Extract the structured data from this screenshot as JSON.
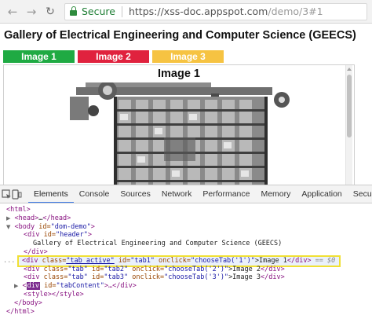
{
  "browser": {
    "secure_label": "Secure",
    "url_host": "https://xss-doc.appspot.com",
    "url_path": "/demo/3#1"
  },
  "page": {
    "title": "Gallery of Electrical Engineering and Computer Science (GEECS)",
    "tabs": [
      {
        "label": "Image 1",
        "color": "#1faa43"
      },
      {
        "label": "Image 2",
        "color": "#e0223e"
      },
      {
        "label": "Image 3",
        "color": "#f6c342"
      }
    ],
    "content_heading": "Image 1"
  },
  "devtools": {
    "tabs": [
      "Elements",
      "Console",
      "Sources",
      "Network",
      "Performance",
      "Memory",
      "Application",
      "Security"
    ],
    "active_tab": "Elements",
    "dom": {
      "l1": "<html>",
      "l2_open": "<head>",
      "l2_dots": "…",
      "l2_close": "</head>",
      "l3_tag": "<body",
      "l3_attr": " id=",
      "l3_val": "\"dom-demo\"",
      "l3_end": ">",
      "l4_tag": "<div",
      "l4_attr": " id=",
      "l4_val": "\"header\"",
      "l4_end": ">",
      "l5_text": "Gallery of Electrical Engineering and Computer Science (GEECS)",
      "l6_close": "</div>",
      "sel_gutter": "...",
      "sel_tag": "<div",
      "sel_attr1": " class=",
      "sel_val1": "\"tab active\"",
      "sel_attr2": " id=",
      "sel_val2": "\"tab1\"",
      "sel_attr3": " onclick=",
      "sel_val3": "\"chooseTab('1')\"",
      "sel_text": ">Image 1",
      "sel_close": "</div>",
      "sel_eq": " == $0",
      "r2_tag": "<div",
      "r2_attr1": " class=",
      "r2_val1": "\"tab\"",
      "r2_attr2": " id=",
      "r2_val2": "\"tab2\"",
      "r2_attr3": " onclick=",
      "r2_val3": "\"chooseTab('2')\"",
      "r2_text": ">Image 2",
      "r2_close": "</div>",
      "r3_tag": "<div",
      "r3_attr1": " class=",
      "r3_val1": "\"tab\"",
      "r3_attr2": " id=",
      "r3_val2": "\"tab3\"",
      "r3_attr3": " onclick=",
      "r3_val3": "\"chooseTab('3')\"",
      "r3_text": ">Image 3",
      "r3_close": "</div>",
      "r4_div": "div",
      "r4_attr": " id=",
      "r4_val": "\"tabContent\"",
      "r4_end": ">…</div>",
      "r5": "<style></style>",
      "r6": "</body>",
      "r7": "</html>"
    }
  }
}
